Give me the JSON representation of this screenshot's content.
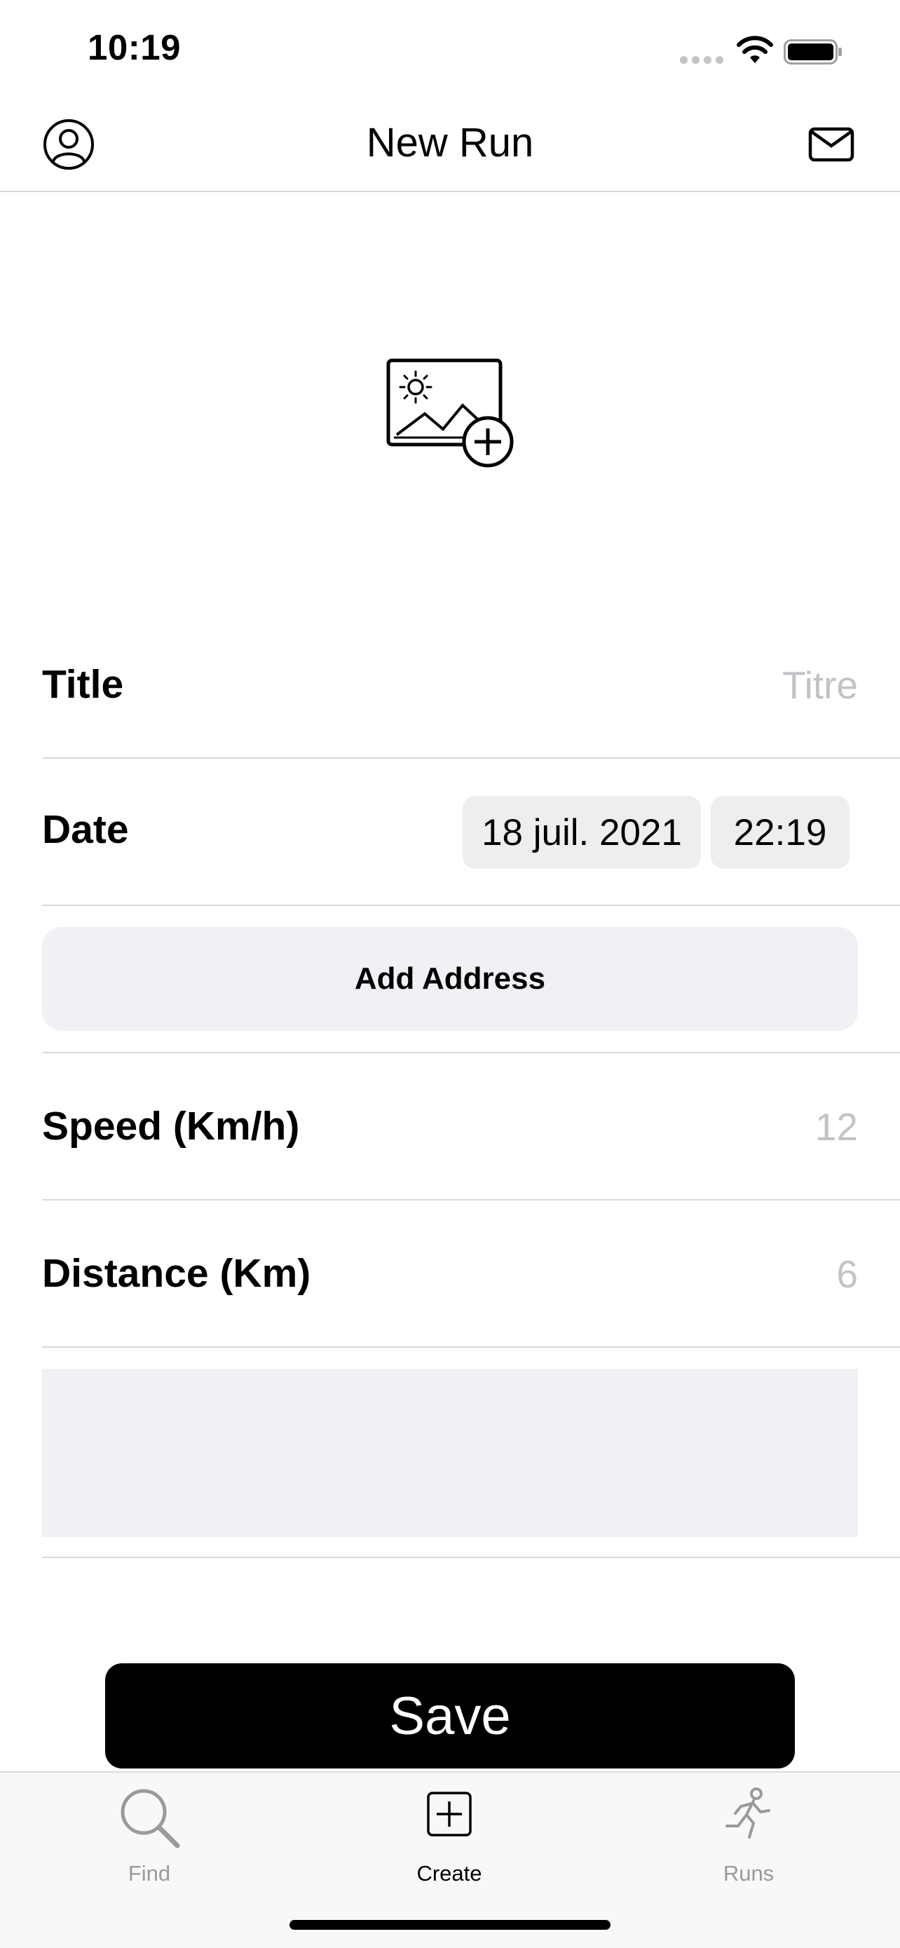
{
  "status_bar": {
    "time": "10:19",
    "icons": [
      "signal-dots-icon",
      "wifi-icon",
      "battery-icon"
    ]
  },
  "nav": {
    "title": "New Run",
    "left_icon": "profile-icon",
    "right_icon": "mail-icon"
  },
  "photo": {
    "icon": "add-photo-icon"
  },
  "form": {
    "title": {
      "label": "Title",
      "placeholder": "Titre"
    },
    "date": {
      "label": "Date",
      "date_value": "18 juil. 2021",
      "time_value": "22:19"
    },
    "address": {
      "button_label": "Add Address"
    },
    "speed": {
      "label": "Speed (Km/h)",
      "placeholder": "12"
    },
    "distance": {
      "label": "Distance (Km)",
      "placeholder": "6"
    },
    "notes": {
      "value": ""
    }
  },
  "save_button": {
    "label": "Save"
  },
  "tab_bar": {
    "tabs": [
      {
        "label": "Find",
        "icon": "search-icon",
        "active": false
      },
      {
        "label": "Create",
        "icon": "plus-square-icon",
        "active": true
      },
      {
        "label": "Runs",
        "icon": "runner-icon",
        "active": false
      }
    ]
  },
  "colors": {
    "placeholder": "#c2c2c7",
    "field_background": "#f1f1f5",
    "divider": "#d9d9dc",
    "tab_inactive": "#9a9a9a",
    "save_background": "#000000"
  }
}
